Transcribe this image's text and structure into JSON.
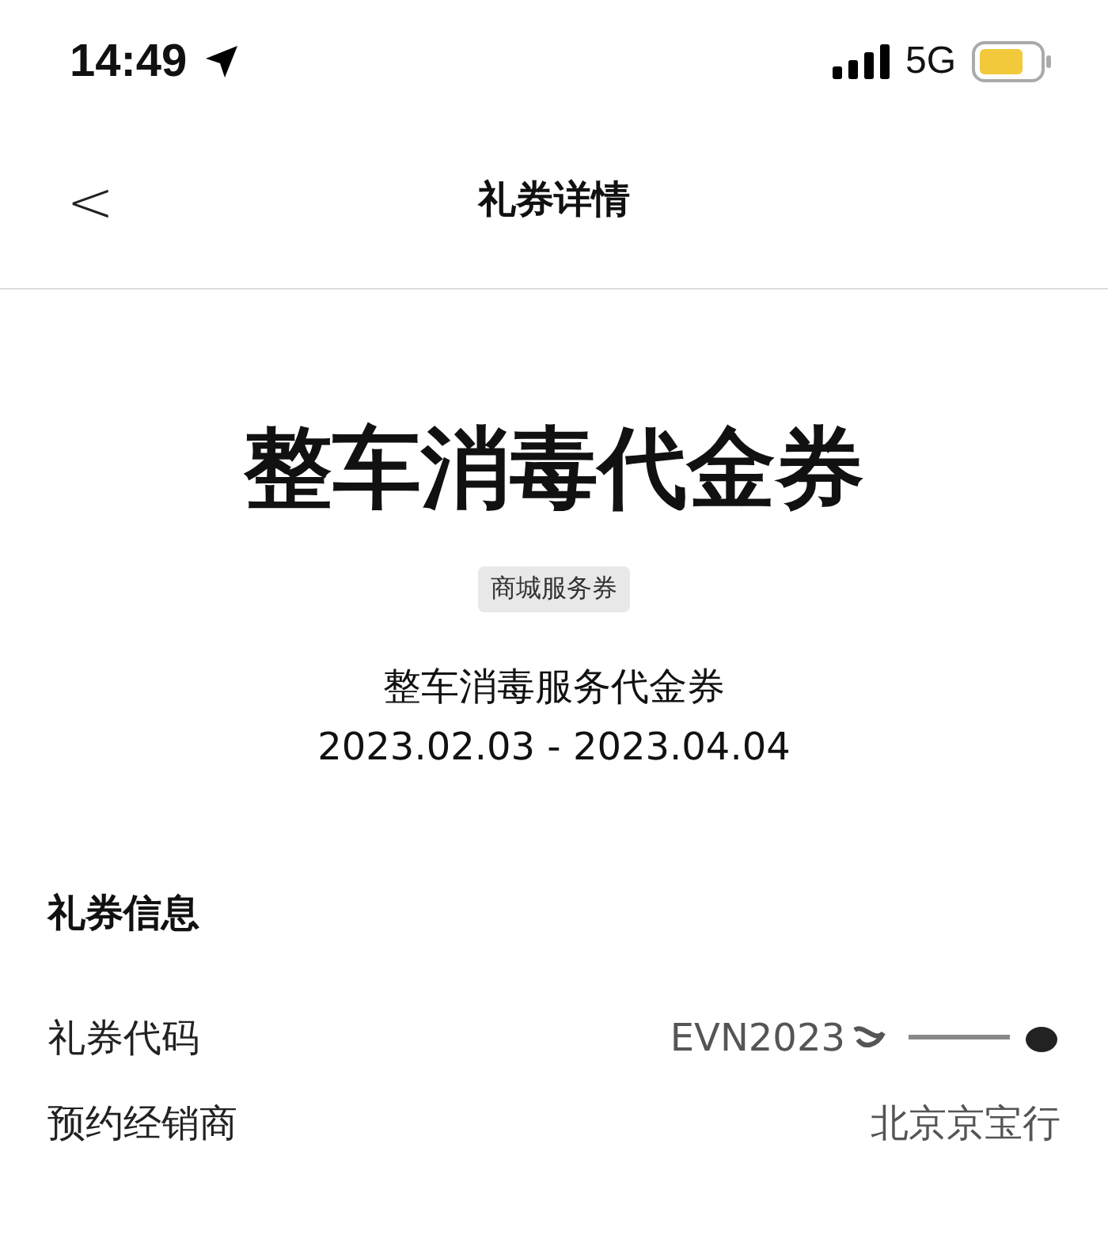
{
  "status_bar": {
    "time": "14:49",
    "network": "5G"
  },
  "nav": {
    "back": "<",
    "title": "礼券详情"
  },
  "coupon": {
    "name": "整车消毒代金券",
    "tag": "商城服务券",
    "description": "整车消毒服务代金券",
    "validity": "2023.02.03 - 2023.04.04"
  },
  "info": {
    "heading": "礼券信息",
    "rows": [
      {
        "kind": "scribbled",
        "label": "礼券代码",
        "value": "EVN2023"
      },
      {
        "kind": "plain",
        "label": "预约经销商",
        "value": "北京京宝行"
      }
    ]
  }
}
